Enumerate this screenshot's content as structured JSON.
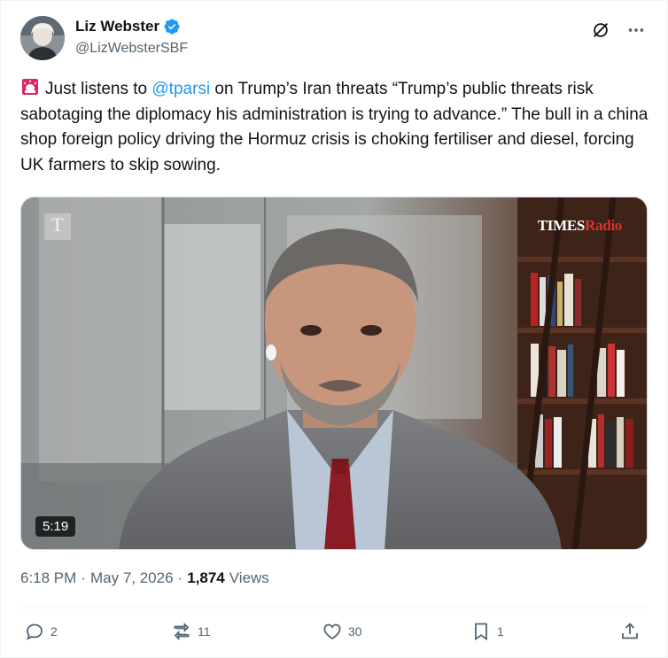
{
  "author": {
    "display_name": "Liz Webster",
    "handle": "@LizWebsterSBF",
    "verified_icon": "verified-badge-icon"
  },
  "tweet": {
    "emoji": "🚨",
    "text_part1": "Just listens to ",
    "mention": "@tparsi",
    "text_part2": " on Trump’s Iran threats “Trump’s public threats risk sabotaging the diplomacy his administration is trying to advance.” The bull in a china shop foreign policy driving the Hormuz crisis is choking fertiliser and diesel, forcing UK farmers to skip sowing."
  },
  "media": {
    "duration": "5:19",
    "watermark_times": "TIMES",
    "watermark_radio": "Radio",
    "corner_logo": "T"
  },
  "meta": {
    "time": "6:18 PM",
    "separator": "·",
    "date": "May 7, 2026",
    "views_count": "1,874",
    "views_label": "Views"
  },
  "actions": {
    "replies": "2",
    "reposts": "11",
    "likes": "30",
    "bookmarks": "1"
  },
  "colors": {
    "accent": "#1d9bf0",
    "text": "#0f1419",
    "secondary": "#536471"
  }
}
